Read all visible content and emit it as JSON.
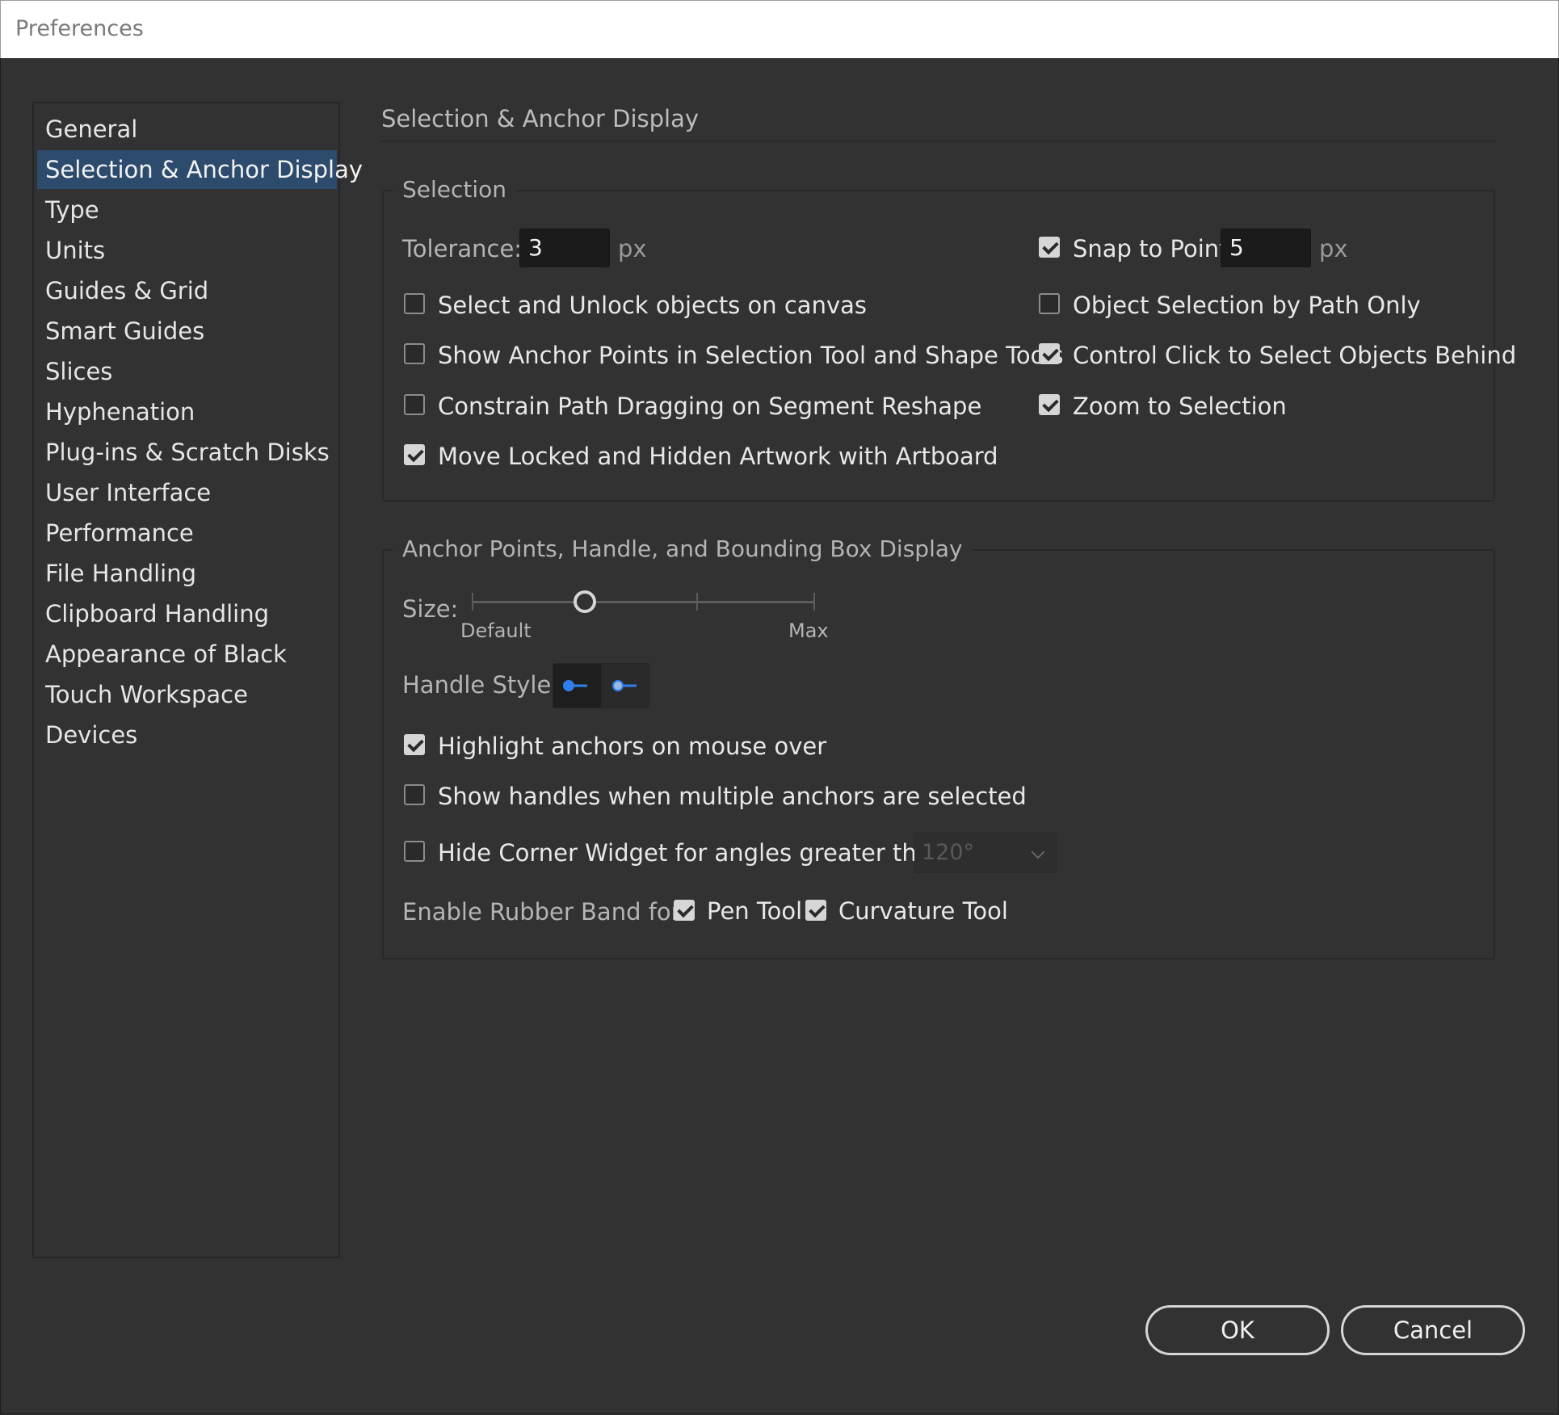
{
  "window": {
    "title": "Preferences"
  },
  "sidebar": {
    "items": [
      {
        "label": "General"
      },
      {
        "label": "Selection & Anchor Display",
        "active": true
      },
      {
        "label": "Type"
      },
      {
        "label": "Units"
      },
      {
        "label": "Guides & Grid"
      },
      {
        "label": "Smart Guides"
      },
      {
        "label": "Slices"
      },
      {
        "label": "Hyphenation"
      },
      {
        "label": "Plug-ins & Scratch Disks"
      },
      {
        "label": "User Interface"
      },
      {
        "label": "Performance"
      },
      {
        "label": "File Handling"
      },
      {
        "label": "Clipboard Handling"
      },
      {
        "label": "Appearance of Black"
      },
      {
        "label": "Touch Workspace"
      },
      {
        "label": "Devices"
      }
    ]
  },
  "page": {
    "heading": "Selection & Anchor Display"
  },
  "selection": {
    "legend": "Selection",
    "tolerance_label": "Tolerance:",
    "tolerance_value": "3",
    "tolerance_unit": "px",
    "snap_label": "Snap to Point",
    "snap_checked": true,
    "snap_value": "5",
    "snap_unit": "px",
    "options": {
      "select_unlock": {
        "label": "Select and Unlock objects on canvas",
        "checked": false
      },
      "show_anchor_points": {
        "label": "Show Anchor Points in Selection Tool and Shape Tools",
        "checked": false
      },
      "constrain_path": {
        "label": "Constrain Path Dragging on Segment Reshape",
        "checked": false
      },
      "move_locked": {
        "label": "Move Locked and Hidden Artwork with Artboard",
        "checked": true
      },
      "object_by_path": {
        "label": "Object Selection by Path Only",
        "checked": false
      },
      "control_click": {
        "label": "Control Click to Select Objects Behind",
        "checked": true
      },
      "zoom_to_selection": {
        "label": "Zoom to Selection",
        "checked": true
      }
    }
  },
  "anchor": {
    "legend": "Anchor Points, Handle, and Bounding Box Display",
    "size_label": "Size:",
    "size_min_label": "Default",
    "size_max_label": "Max",
    "size_level_fraction": 0.33,
    "handle_style_label": "Handle Style:",
    "handle_styles": [
      {
        "icon": "handle-solid-icon",
        "selected": true
      },
      {
        "icon": "handle-hollow-icon",
        "selected": false
      }
    ],
    "highlight": {
      "label": "Highlight anchors on mouse over",
      "checked": true
    },
    "show_handles": {
      "label": "Show handles when multiple anchors are selected",
      "checked": false
    },
    "hide_corner": {
      "label": "Hide Corner Widget for angles greater than:",
      "checked": false
    },
    "corner_angle": "120°",
    "rubber_band_label": "Enable Rubber Band for:",
    "pen_tool": {
      "label": "Pen Tool",
      "checked": true
    },
    "curvature_tool": {
      "label": "Curvature Tool",
      "checked": true
    }
  },
  "footer": {
    "ok_label": "OK",
    "cancel_label": "Cancel"
  },
  "colors": {
    "background": "#323232",
    "selected_item": "#2d4b6d",
    "accent_blue": "#2f80ed"
  }
}
